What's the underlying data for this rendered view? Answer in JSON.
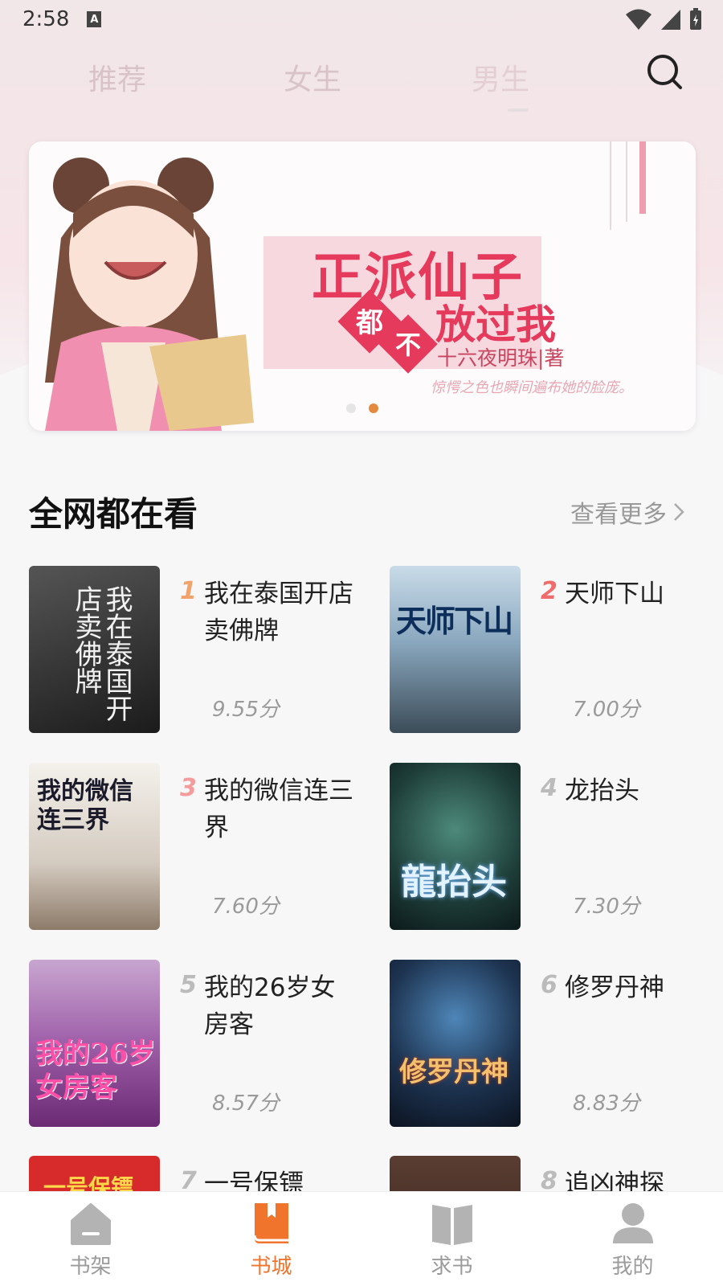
{
  "status": {
    "time": "2:58",
    "notif_icon": "A"
  },
  "tabs": [
    {
      "label": "推荐",
      "active": false
    },
    {
      "label": "女生",
      "active": false
    },
    {
      "label": "男生",
      "active": true
    }
  ],
  "banner": {
    "title_line1": "正派仙子",
    "title_dou": "都",
    "title_bu": "不",
    "title_line2_rest": "放过我",
    "author": "十六夜明珠|著",
    "tagline": "惊愕之色也瞬间遍布她的脸庞。",
    "dots": 2,
    "active_dot": 1
  },
  "section": {
    "title": "全网都在看",
    "more_label": "查看更多"
  },
  "books": [
    {
      "rank": "1",
      "title": "我在泰国开店卖佛牌",
      "score": "9.55分",
      "rank_color": "#f2a36b",
      "cover_text": "我在泰国开店卖佛牌",
      "cover_bg": "#2b2b2b"
    },
    {
      "rank": "2",
      "title": "天师下山",
      "score": "7.00分",
      "rank_color": "#f06b6b",
      "cover_text": "天师下山",
      "cover_bg": "#5f7d96"
    },
    {
      "rank": "3",
      "title": "我的微信连三界",
      "score": "7.60分",
      "rank_color": "#f49b9b",
      "cover_text": "我的微信连三界",
      "cover_bg": "#d9d3cc"
    },
    {
      "rank": "4",
      "title": "龙抬头",
      "score": "7.30分",
      "rank_color": "#bbbbbb",
      "cover_text": "龍抬头",
      "cover_bg": "#1f4a46"
    },
    {
      "rank": "5",
      "title": "我的26岁女房客",
      "score": "8.57分",
      "rank_color": "#bbbbbb",
      "cover_text": "我的26岁女房客",
      "cover_bg": "#8a3f8e"
    },
    {
      "rank": "6",
      "title": "修罗丹神",
      "score": "8.83分",
      "rank_color": "#bbbbbb",
      "cover_text": "修罗丹神",
      "cover_bg": "#1d2e3f"
    },
    {
      "rank": "7",
      "title": "一号保镖",
      "score": "",
      "rank_color": "#bbbbbb",
      "cover_text": "一号保镖",
      "cover_bg": "#d72b2b"
    },
    {
      "rank": "8",
      "title": "追凶神探",
      "score": "",
      "rank_color": "#bbbbbb",
      "cover_text": "",
      "cover_bg": "#5a3d32"
    }
  ],
  "nav": [
    {
      "label": "书架",
      "icon": "shelf-icon",
      "active": false
    },
    {
      "label": "书城",
      "icon": "book-icon",
      "active": true
    },
    {
      "label": "求书",
      "icon": "open-book-icon",
      "active": false
    },
    {
      "label": "我的",
      "icon": "user-icon",
      "active": false
    }
  ],
  "colors": {
    "accent": "#f0742c",
    "dot_active": "#e58a3d"
  }
}
